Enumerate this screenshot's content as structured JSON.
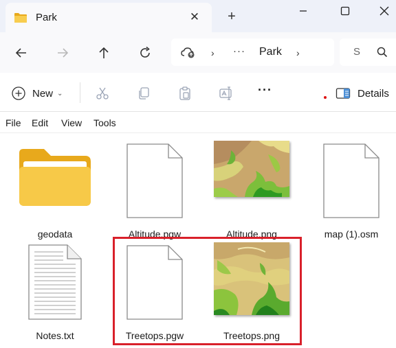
{
  "window": {
    "tab_title": "Park",
    "new_tab_symbol": "+",
    "close_tab_symbol": "✕"
  },
  "address_bar": {
    "overflow": "···",
    "crumb": "Park",
    "chevron": "›"
  },
  "search": {
    "placeholder": "S"
  },
  "command_bar": {
    "new_label": "New",
    "new_caret": "⌄",
    "more": "···",
    "details_label": "Details"
  },
  "menu": {
    "items": [
      "File",
      "Edit",
      "View",
      "Tools"
    ]
  },
  "files": [
    {
      "name": "geodata",
      "type": "folder"
    },
    {
      "name": "Altitude.pgw",
      "type": "document"
    },
    {
      "name": "Altitude.png",
      "type": "image"
    },
    {
      "name": "map (1).osm",
      "type": "document"
    },
    {
      "name": "Notes.txt",
      "type": "text"
    },
    {
      "name": "Treetops.pgw",
      "type": "document"
    },
    {
      "name": "Treetops.png",
      "type": "image"
    }
  ],
  "colors": {
    "selection_highlight": "#d9202a",
    "folder": "#f6c544",
    "titlebar": "#eef1f9"
  }
}
